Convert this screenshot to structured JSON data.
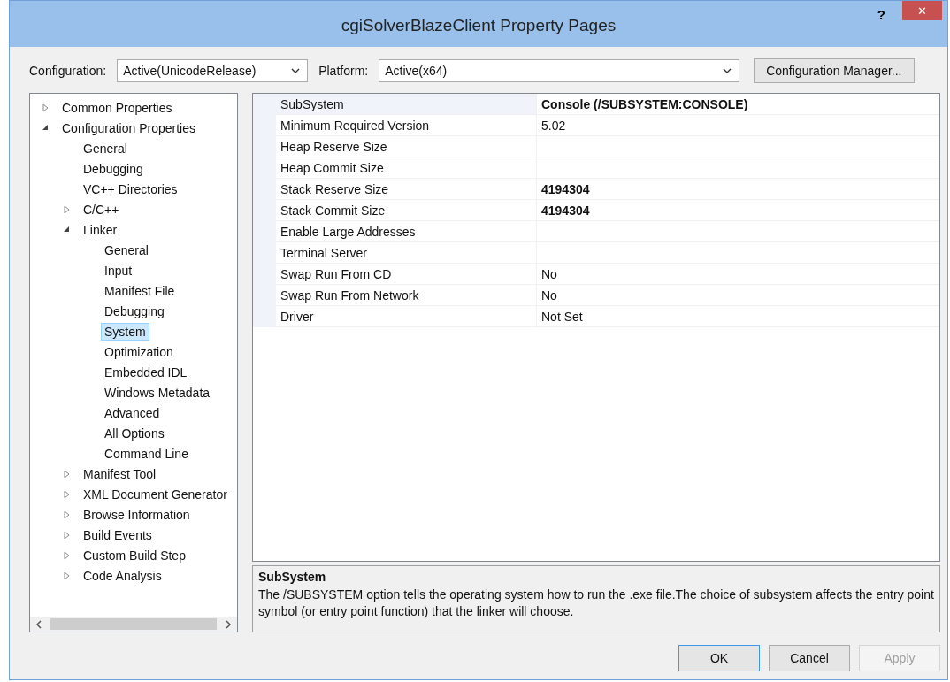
{
  "window": {
    "title": "cgiSolverBlazeClient Property Pages",
    "help": "?",
    "close": "✕"
  },
  "toolbar": {
    "configuration": {
      "label": "Configuration:",
      "value": "Active(UnicodeRelease)"
    },
    "platform": {
      "label": "Platform:",
      "value": "Active(x64)"
    },
    "manager_button": "Configuration Manager..."
  },
  "tree": [
    {
      "label": "Common Properties",
      "selected": false,
      "expanded": false
    },
    {
      "label": "Configuration Properties",
      "selected": false,
      "expanded": true,
      "children": [
        {
          "label": "General",
          "selected": false
        },
        {
          "label": "Debugging",
          "selected": false
        },
        {
          "label": "VC++ Directories",
          "selected": false
        },
        {
          "label": "C/C++",
          "selected": false,
          "expanded": false
        },
        {
          "label": "Linker",
          "selected": false,
          "expanded": true,
          "children": [
            {
              "label": "General",
              "selected": false
            },
            {
              "label": "Input",
              "selected": false
            },
            {
              "label": "Manifest File",
              "selected": false
            },
            {
              "label": "Debugging",
              "selected": false
            },
            {
              "label": "System",
              "selected": true
            },
            {
              "label": "Optimization",
              "selected": false
            },
            {
              "label": "Embedded IDL",
              "selected": false
            },
            {
              "label": "Windows Metadata",
              "selected": false
            },
            {
              "label": "Advanced",
              "selected": false
            },
            {
              "label": "All Options",
              "selected": false
            },
            {
              "label": "Command Line",
              "selected": false
            }
          ]
        },
        {
          "label": "Manifest Tool",
          "selected": false,
          "expanded": false
        },
        {
          "label": "XML Document Generator",
          "selected": false,
          "expanded": false
        },
        {
          "label": "Browse Information",
          "selected": false,
          "expanded": false
        },
        {
          "label": "Build Events",
          "selected": false,
          "expanded": false
        },
        {
          "label": "Custom Build Step",
          "selected": false,
          "expanded": false
        },
        {
          "label": "Code Analysis",
          "selected": false,
          "expanded": false
        }
      ]
    }
  ],
  "properties": [
    {
      "name": "SubSystem",
      "value": "Console (/SUBSYSTEM:CONSOLE)",
      "bold": true,
      "selected": true
    },
    {
      "name": "Minimum Required Version",
      "value": "5.02",
      "bold": false,
      "selected": false
    },
    {
      "name": "Heap Reserve Size",
      "selected": false
    },
    {
      "name": "Heap Commit Size",
      "selected": false
    },
    {
      "name": "Stack Reserve Size",
      "value": "4194304",
      "bold": true,
      "selected": false
    },
    {
      "name": "Stack Commit Size",
      "value": "4194304",
      "bold": true,
      "selected": false
    },
    {
      "name": "Enable Large Addresses",
      "selected": false
    },
    {
      "name": "Terminal Server",
      "selected": false
    },
    {
      "name": "Swap Run From CD",
      "value": "No",
      "bold": false,
      "selected": false
    },
    {
      "name": "Swap Run From Network",
      "value": "No",
      "bold": false,
      "selected": false
    },
    {
      "name": "Driver",
      "value": "Not Set",
      "bold": false,
      "selected": false
    }
  ],
  "description": {
    "title": "SubSystem",
    "text": "The /SUBSYSTEM option tells the operating system how to run the .exe file.The choice of subsystem affects the entry point symbol (or entry point function) that the linker will choose."
  },
  "buttons": [
    {
      "label": "OK",
      "disabled": false,
      "default": true
    },
    {
      "label": "Cancel",
      "disabled": false,
      "default": false
    },
    {
      "label": "Apply",
      "disabled": true,
      "default": false
    }
  ]
}
